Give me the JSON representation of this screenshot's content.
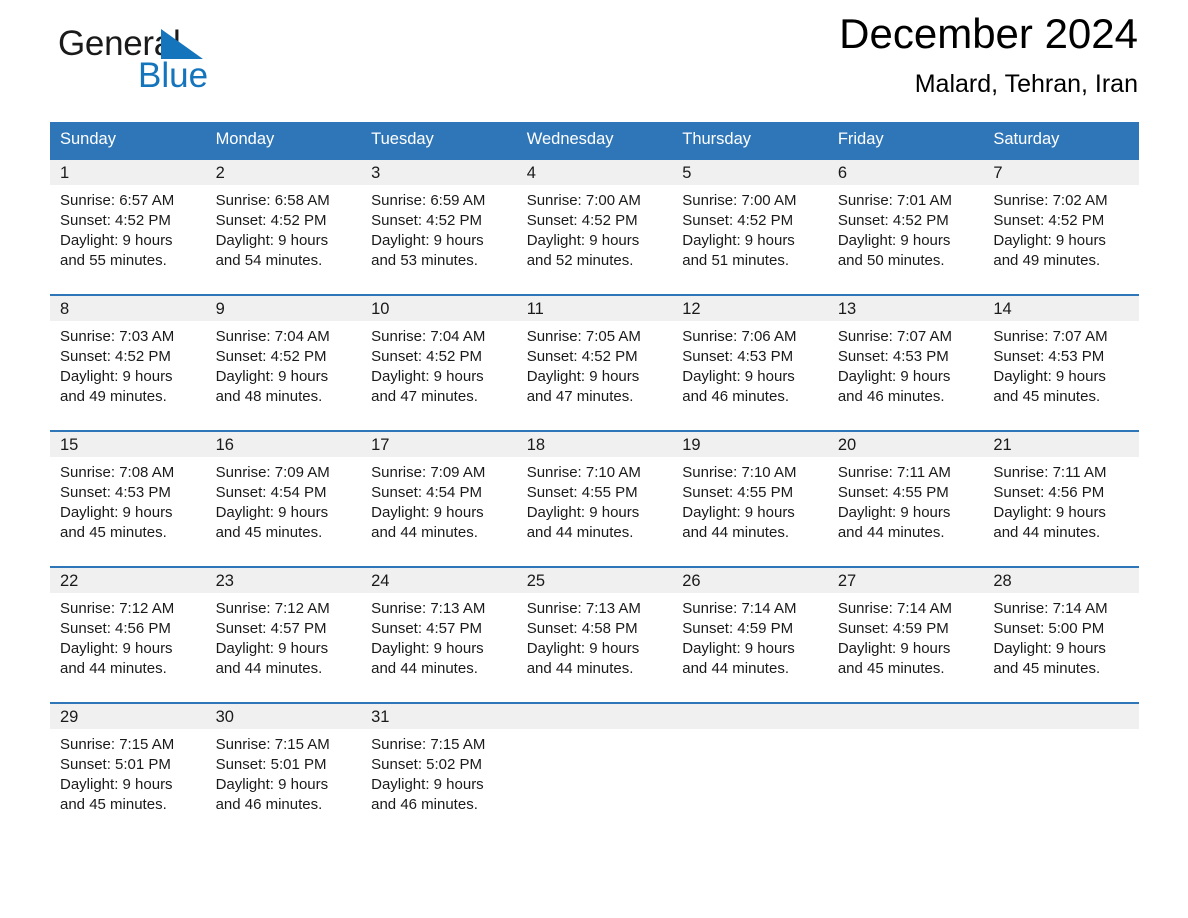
{
  "brand": {
    "name_part1": "General",
    "name_part2": "Blue",
    "triangle_icon": "brand-triangle-icon",
    "accent_color": "#1474bc"
  },
  "header": {
    "title": "December 2024",
    "location": "Malard, Tehran, Iran"
  },
  "calendar": {
    "header_bg": "#2f76b9",
    "daynum_band_bg": "#f0f0f0",
    "weekdays": [
      "Sunday",
      "Monday",
      "Tuesday",
      "Wednesday",
      "Thursday",
      "Friday",
      "Saturday"
    ],
    "weeks": [
      [
        {
          "day": "1",
          "sunrise": "Sunrise: 6:57 AM",
          "sunset": "Sunset: 4:52 PM",
          "daylight_line1": "Daylight: 9 hours",
          "daylight_line2": "and 55 minutes."
        },
        {
          "day": "2",
          "sunrise": "Sunrise: 6:58 AM",
          "sunset": "Sunset: 4:52 PM",
          "daylight_line1": "Daylight: 9 hours",
          "daylight_line2": "and 54 minutes."
        },
        {
          "day": "3",
          "sunrise": "Sunrise: 6:59 AM",
          "sunset": "Sunset: 4:52 PM",
          "daylight_line1": "Daylight: 9 hours",
          "daylight_line2": "and 53 minutes."
        },
        {
          "day": "4",
          "sunrise": "Sunrise: 7:00 AM",
          "sunset": "Sunset: 4:52 PM",
          "daylight_line1": "Daylight: 9 hours",
          "daylight_line2": "and 52 minutes."
        },
        {
          "day": "5",
          "sunrise": "Sunrise: 7:00 AM",
          "sunset": "Sunset: 4:52 PM",
          "daylight_line1": "Daylight: 9 hours",
          "daylight_line2": "and 51 minutes."
        },
        {
          "day": "6",
          "sunrise": "Sunrise: 7:01 AM",
          "sunset": "Sunset: 4:52 PM",
          "daylight_line1": "Daylight: 9 hours",
          "daylight_line2": "and 50 minutes."
        },
        {
          "day": "7",
          "sunrise": "Sunrise: 7:02 AM",
          "sunset": "Sunset: 4:52 PM",
          "daylight_line1": "Daylight: 9 hours",
          "daylight_line2": "and 49 minutes."
        }
      ],
      [
        {
          "day": "8",
          "sunrise": "Sunrise: 7:03 AM",
          "sunset": "Sunset: 4:52 PM",
          "daylight_line1": "Daylight: 9 hours",
          "daylight_line2": "and 49 minutes."
        },
        {
          "day": "9",
          "sunrise": "Sunrise: 7:04 AM",
          "sunset": "Sunset: 4:52 PM",
          "daylight_line1": "Daylight: 9 hours",
          "daylight_line2": "and 48 minutes."
        },
        {
          "day": "10",
          "sunrise": "Sunrise: 7:04 AM",
          "sunset": "Sunset: 4:52 PM",
          "daylight_line1": "Daylight: 9 hours",
          "daylight_line2": "and 47 minutes."
        },
        {
          "day": "11",
          "sunrise": "Sunrise: 7:05 AM",
          "sunset": "Sunset: 4:52 PM",
          "daylight_line1": "Daylight: 9 hours",
          "daylight_line2": "and 47 minutes."
        },
        {
          "day": "12",
          "sunrise": "Sunrise: 7:06 AM",
          "sunset": "Sunset: 4:53 PM",
          "daylight_line1": "Daylight: 9 hours",
          "daylight_line2": "and 46 minutes."
        },
        {
          "day": "13",
          "sunrise": "Sunrise: 7:07 AM",
          "sunset": "Sunset: 4:53 PM",
          "daylight_line1": "Daylight: 9 hours",
          "daylight_line2": "and 46 minutes."
        },
        {
          "day": "14",
          "sunrise": "Sunrise: 7:07 AM",
          "sunset": "Sunset: 4:53 PM",
          "daylight_line1": "Daylight: 9 hours",
          "daylight_line2": "and 45 minutes."
        }
      ],
      [
        {
          "day": "15",
          "sunrise": "Sunrise: 7:08 AM",
          "sunset": "Sunset: 4:53 PM",
          "daylight_line1": "Daylight: 9 hours",
          "daylight_line2": "and 45 minutes."
        },
        {
          "day": "16",
          "sunrise": "Sunrise: 7:09 AM",
          "sunset": "Sunset: 4:54 PM",
          "daylight_line1": "Daylight: 9 hours",
          "daylight_line2": "and 45 minutes."
        },
        {
          "day": "17",
          "sunrise": "Sunrise: 7:09 AM",
          "sunset": "Sunset: 4:54 PM",
          "daylight_line1": "Daylight: 9 hours",
          "daylight_line2": "and 44 minutes."
        },
        {
          "day": "18",
          "sunrise": "Sunrise: 7:10 AM",
          "sunset": "Sunset: 4:55 PM",
          "daylight_line1": "Daylight: 9 hours",
          "daylight_line2": "and 44 minutes."
        },
        {
          "day": "19",
          "sunrise": "Sunrise: 7:10 AM",
          "sunset": "Sunset: 4:55 PM",
          "daylight_line1": "Daylight: 9 hours",
          "daylight_line2": "and 44 minutes."
        },
        {
          "day": "20",
          "sunrise": "Sunrise: 7:11 AM",
          "sunset": "Sunset: 4:55 PM",
          "daylight_line1": "Daylight: 9 hours",
          "daylight_line2": "and 44 minutes."
        },
        {
          "day": "21",
          "sunrise": "Sunrise: 7:11 AM",
          "sunset": "Sunset: 4:56 PM",
          "daylight_line1": "Daylight: 9 hours",
          "daylight_line2": "and 44 minutes."
        }
      ],
      [
        {
          "day": "22",
          "sunrise": "Sunrise: 7:12 AM",
          "sunset": "Sunset: 4:56 PM",
          "daylight_line1": "Daylight: 9 hours",
          "daylight_line2": "and 44 minutes."
        },
        {
          "day": "23",
          "sunrise": "Sunrise: 7:12 AM",
          "sunset": "Sunset: 4:57 PM",
          "daylight_line1": "Daylight: 9 hours",
          "daylight_line2": "and 44 minutes."
        },
        {
          "day": "24",
          "sunrise": "Sunrise: 7:13 AM",
          "sunset": "Sunset: 4:57 PM",
          "daylight_line1": "Daylight: 9 hours",
          "daylight_line2": "and 44 minutes."
        },
        {
          "day": "25",
          "sunrise": "Sunrise: 7:13 AM",
          "sunset": "Sunset: 4:58 PM",
          "daylight_line1": "Daylight: 9 hours",
          "daylight_line2": "and 44 minutes."
        },
        {
          "day": "26",
          "sunrise": "Sunrise: 7:14 AM",
          "sunset": "Sunset: 4:59 PM",
          "daylight_line1": "Daylight: 9 hours",
          "daylight_line2": "and 44 minutes."
        },
        {
          "day": "27",
          "sunrise": "Sunrise: 7:14 AM",
          "sunset": "Sunset: 4:59 PM",
          "daylight_line1": "Daylight: 9 hours",
          "daylight_line2": "and 45 minutes."
        },
        {
          "day": "28",
          "sunrise": "Sunrise: 7:14 AM",
          "sunset": "Sunset: 5:00 PM",
          "daylight_line1": "Daylight: 9 hours",
          "daylight_line2": "and 45 minutes."
        }
      ],
      [
        {
          "day": "29",
          "sunrise": "Sunrise: 7:15 AM",
          "sunset": "Sunset: 5:01 PM",
          "daylight_line1": "Daylight: 9 hours",
          "daylight_line2": "and 45 minutes."
        },
        {
          "day": "30",
          "sunrise": "Sunrise: 7:15 AM",
          "sunset": "Sunset: 5:01 PM",
          "daylight_line1": "Daylight: 9 hours",
          "daylight_line2": "and 46 minutes."
        },
        {
          "day": "31",
          "sunrise": "Sunrise: 7:15 AM",
          "sunset": "Sunset: 5:02 PM",
          "daylight_line1": "Daylight: 9 hours",
          "daylight_line2": "and 46 minutes."
        },
        {
          "day": "",
          "sunrise": "",
          "sunset": "",
          "daylight_line1": "",
          "daylight_line2": ""
        },
        {
          "day": "",
          "sunrise": "",
          "sunset": "",
          "daylight_line1": "",
          "daylight_line2": ""
        },
        {
          "day": "",
          "sunrise": "",
          "sunset": "",
          "daylight_line1": "",
          "daylight_line2": ""
        },
        {
          "day": "",
          "sunrise": "",
          "sunset": "",
          "daylight_line1": "",
          "daylight_line2": ""
        }
      ]
    ]
  }
}
